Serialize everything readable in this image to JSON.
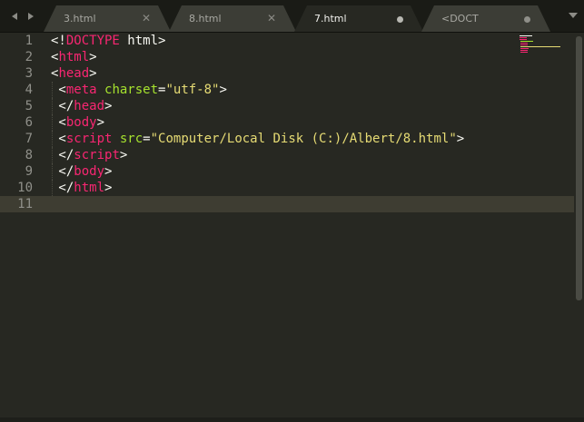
{
  "tabs": [
    {
      "label": "3.html",
      "state": "close"
    },
    {
      "label": "8.html",
      "state": "close"
    },
    {
      "label": "7.html",
      "state": "dirty",
      "active": true
    },
    {
      "label": "<DOCT",
      "state": "dirty"
    }
  ],
  "icons": {
    "nav_left": "triangle-left-icon",
    "nav_right": "triangle-right-icon",
    "tab_close": "close-icon",
    "tab_dirty": "unsaved-dot-icon",
    "tabs_menu": "chevron-down-icon"
  },
  "editor": {
    "current_line": 11,
    "line_numbers": [
      "1",
      "2",
      "3",
      "4",
      "5",
      "6",
      "7",
      "8",
      "9",
      "10",
      "11"
    ],
    "lines": [
      {
        "tokens": [
          {
            "t": "<!",
            "c": "p"
          },
          {
            "t": "DOCTYPE",
            "c": "t"
          },
          {
            "t": " html>",
            "c": "p"
          }
        ]
      },
      {
        "tokens": [
          {
            "t": "<",
            "c": "p"
          },
          {
            "t": "html",
            "c": "t"
          },
          {
            "t": ">",
            "c": "p"
          }
        ]
      },
      {
        "tokens": [
          {
            "t": "<",
            "c": "p"
          },
          {
            "t": "head",
            "c": "t"
          },
          {
            "t": ">",
            "c": "p"
          }
        ]
      },
      {
        "tokens": [
          {
            "t": " <",
            "c": "p"
          },
          {
            "t": "meta",
            "c": "t"
          },
          {
            "t": " ",
            "c": "p"
          },
          {
            "t": "charset",
            "c": "a"
          },
          {
            "t": "=",
            "c": "p"
          },
          {
            "t": "\"utf-8\"",
            "c": "s"
          },
          {
            "t": ">",
            "c": "p"
          }
        ]
      },
      {
        "tokens": [
          {
            "t": " </",
            "c": "p"
          },
          {
            "t": "head",
            "c": "t"
          },
          {
            "t": ">",
            "c": "p"
          }
        ]
      },
      {
        "tokens": [
          {
            "t": " <",
            "c": "p"
          },
          {
            "t": "body",
            "c": "t"
          },
          {
            "t": ">",
            "c": "p"
          }
        ]
      },
      {
        "tokens": [
          {
            "t": " <",
            "c": "p"
          },
          {
            "t": "script",
            "c": "t"
          },
          {
            "t": " ",
            "c": "p"
          },
          {
            "t": "src",
            "c": "a"
          },
          {
            "t": "=",
            "c": "p"
          },
          {
            "t": "\"Computer/Local Disk (C:)/Albert/8.html\"",
            "c": "s"
          },
          {
            "t": ">",
            "c": "p"
          }
        ]
      },
      {
        "tokens": [
          {
            "t": " </",
            "c": "p"
          },
          {
            "t": "script",
            "c": "t"
          },
          {
            "t": ">",
            "c": "p"
          }
        ]
      },
      {
        "tokens": [
          {
            "t": " </",
            "c": "p"
          },
          {
            "t": "body",
            "c": "t"
          },
          {
            "t": ">",
            "c": "p"
          }
        ]
      },
      {
        "tokens": [
          {
            "t": " </",
            "c": "p"
          },
          {
            "t": "html",
            "c": "t"
          },
          {
            "t": ">",
            "c": "p"
          }
        ]
      },
      {
        "tokens": []
      }
    ]
  },
  "colors": {
    "background": "#272822",
    "tag": "#f92672",
    "attribute": "#a6e22e",
    "string": "#e6db74",
    "punctuation": "#f8f8f2",
    "line_number": "#90908a",
    "current_line": "#3e3d32"
  }
}
